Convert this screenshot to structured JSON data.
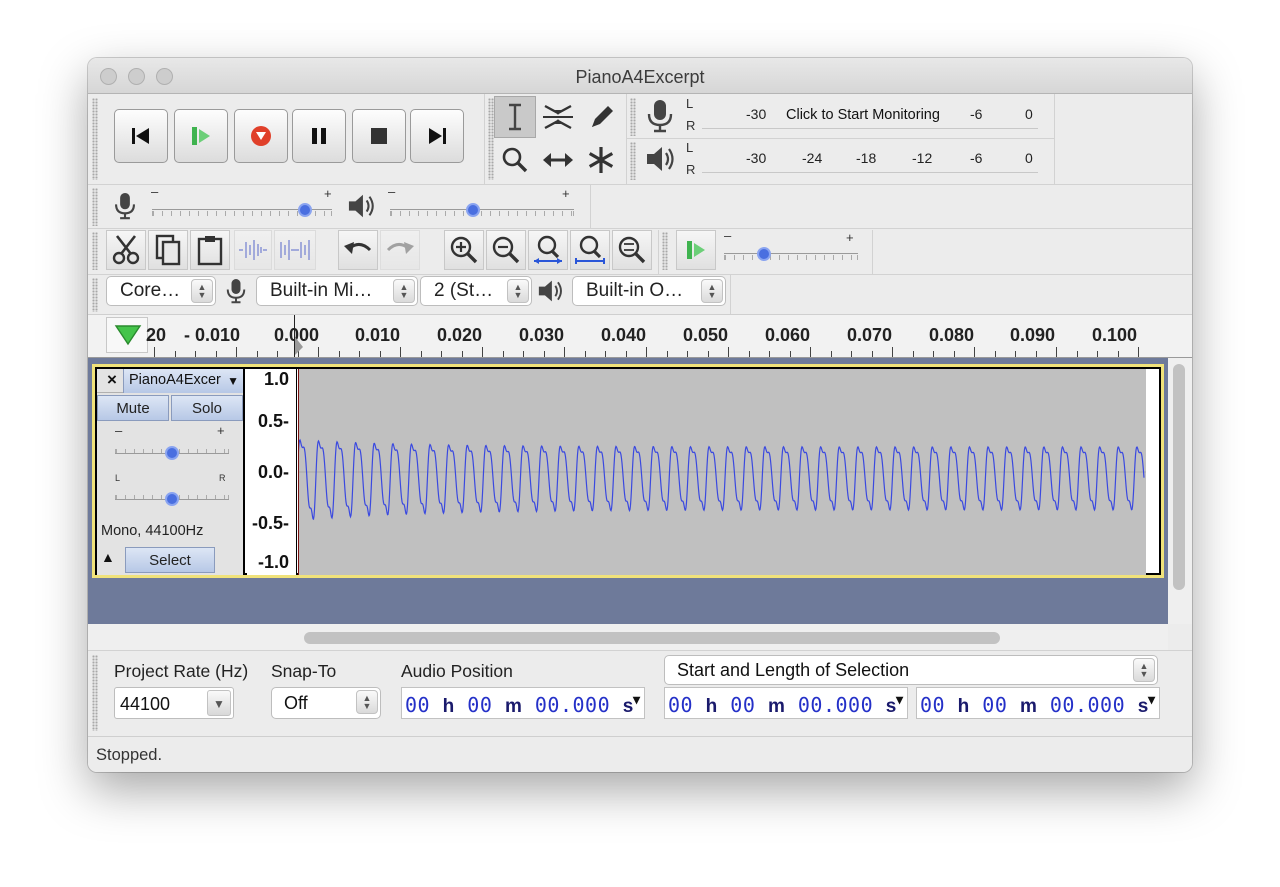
{
  "window": {
    "title": "PianoA4Excerpt"
  },
  "transport": {
    "buttons": [
      "skip-to-start",
      "play",
      "record",
      "pause",
      "stop",
      "skip-to-end"
    ]
  },
  "tools": [
    "selection-tool",
    "envelope-tool",
    "draw-tool",
    "zoom-tool",
    "time-shift-tool",
    "multi-tool"
  ],
  "meters": {
    "record": {
      "channels": [
        "L",
        "R"
      ],
      "scale": [
        "-30",
        "-6",
        "0"
      ],
      "prompt": "Click to Start Monitoring"
    },
    "playback": {
      "channels": [
        "L",
        "R"
      ],
      "scale": [
        "-30",
        "-24",
        "-18",
        "-12",
        "-6",
        "0"
      ]
    }
  },
  "mixer": {
    "recording_volume": 0.85,
    "playback_volume": 0.45,
    "minus": "–",
    "plus": "+"
  },
  "edit": {
    "play_at_speed": 0.3,
    "minus": "–",
    "plus": "+"
  },
  "device": {
    "host": "Core…",
    "input": "Built-in Mi…",
    "channels": "2 (St…",
    "output": "Built-in O…"
  },
  "ruler": {
    "labels": [
      "20",
      "- 0.010",
      "0.000",
      "0.010",
      "0.020",
      "0.030",
      "0.040",
      "0.050",
      "0.060",
      "0.070",
      "0.080",
      "0.090",
      "0.100"
    ]
  },
  "track": {
    "name": "PianoA4Excer",
    "mute_label": "Mute",
    "solo_label": "Solo",
    "gain_minus": "–",
    "gain_plus": "+",
    "pan_left": "L",
    "pan_right": "R",
    "gain": 0.5,
    "pan": 0.5,
    "info": "Mono, 44100Hz",
    "select_label": "Select",
    "vscale": [
      "1.0",
      "0.5-",
      "0.0-",
      "-0.5-",
      "-1.0"
    ],
    "wave_color": "#3a49e0"
  },
  "selection_toolbar": {
    "project_rate_label": "Project Rate (Hz)",
    "project_rate_value": "44100",
    "snap_to_label": "Snap-To",
    "snap_to_value": "Off",
    "audio_position_label": "Audio Position",
    "selection_mode": "Start and Length of Selection",
    "time_h": "00",
    "time_m": "00",
    "time_s": "00.000",
    "unit_h": "h",
    "unit_m": "m",
    "unit_s": "s"
  },
  "status": {
    "text": "Stopped."
  },
  "colors": {
    "accent": "#4a6fe0",
    "play": "#3fb34f",
    "record": "#e0402a",
    "track_bg": "#6e7a9a",
    "selection_border": "#f0e27a"
  }
}
